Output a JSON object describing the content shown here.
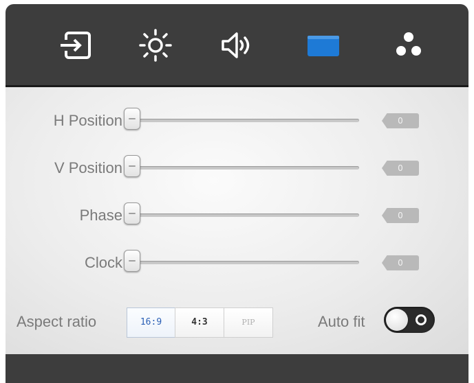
{
  "tabs": [
    {
      "icon": "input-source-icon",
      "active": false
    },
    {
      "icon": "brightness-icon",
      "active": false
    },
    {
      "icon": "volume-icon",
      "active": false
    },
    {
      "icon": "display-icon",
      "active": true
    },
    {
      "icon": "color-dots-icon",
      "active": false
    }
  ],
  "colors": {
    "active_tab": "#1e7ad6",
    "icon": "#ffffff",
    "panel_dark": "#3d3d3d"
  },
  "sliders": [
    {
      "label": "H Position",
      "value": "0",
      "level": 0
    },
    {
      "label": "V Position",
      "value": "0",
      "level": 0
    },
    {
      "label": "Phase",
      "value": "0",
      "level": 0
    },
    {
      "label": "Clock",
      "value": "0",
      "level": 0
    }
  ],
  "aspect": {
    "label": "Aspect ratio",
    "options": [
      "16:9",
      "4:3",
      "PIP"
    ],
    "selected": "16:9"
  },
  "autofit": {
    "label": "Auto fit",
    "on": false
  }
}
